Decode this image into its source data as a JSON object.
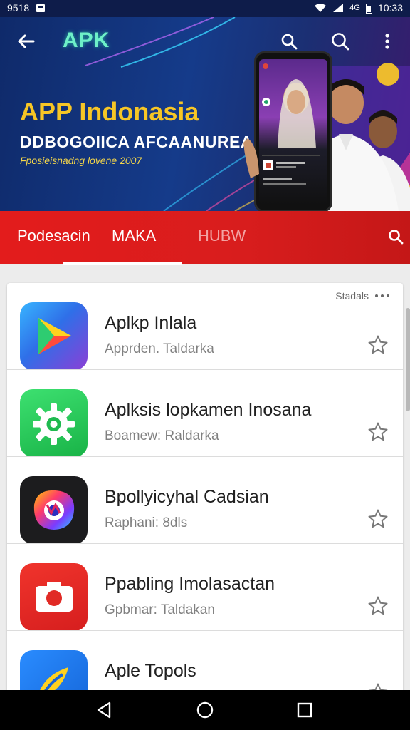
{
  "status_bar": {
    "time_left": "9518",
    "network": "4G",
    "time_right": "10:33"
  },
  "toolbar": {
    "back_icon": "back-arrow-icon",
    "brand": "APK",
    "search_icon": "search-icon",
    "search2_icon": "search-icon",
    "more_icon": "more-vertical-icon"
  },
  "banner": {
    "title": "APP Indonasia",
    "subtitle": "DDBOGOIICA AFCAANUREA",
    "caption": "Fposieisnadng lovene 2007",
    "title_color": "#f7c625"
  },
  "tabs": {
    "items": [
      {
        "label": "Podesacin"
      },
      {
        "label": "MAKA"
      },
      {
        "label": "HUBW"
      }
    ],
    "active_index": 1,
    "search_icon": "search-icon",
    "bar_color": "#e31c1c"
  },
  "list": {
    "header_label": "Stadals",
    "header_icon": "more-horizontal-icon",
    "apps": [
      {
        "name": "Aplkp Inlala",
        "subtitle": "Apprden. Taldarka",
        "icon": "play-triangle-icon",
        "star_icon": "star-outline-icon"
      },
      {
        "name": "Aplksis lopkamen Inosana",
        "subtitle": "Boamew: Raldarka",
        "icon": "gear-icon",
        "star_icon": "star-outline-icon"
      },
      {
        "name": "Bpollyicyhal Cadsian",
        "subtitle": "Raphani: 8dls",
        "icon": "camera-lens-icon",
        "star_icon": "star-outline-icon"
      },
      {
        "name": "Ppabling Imolasactan",
        "subtitle": "Gpbmar: Taldakan",
        "icon": "camera-icon",
        "star_icon": "star-outline-icon"
      },
      {
        "name": "Aple Topols",
        "subtitle": "",
        "icon": "pen-icon",
        "star_icon": "star-outline-icon"
      }
    ]
  },
  "nav_bar": {
    "back_icon": "nav-back-icon",
    "home_icon": "nav-home-icon",
    "recents_icon": "nav-recents-icon"
  }
}
